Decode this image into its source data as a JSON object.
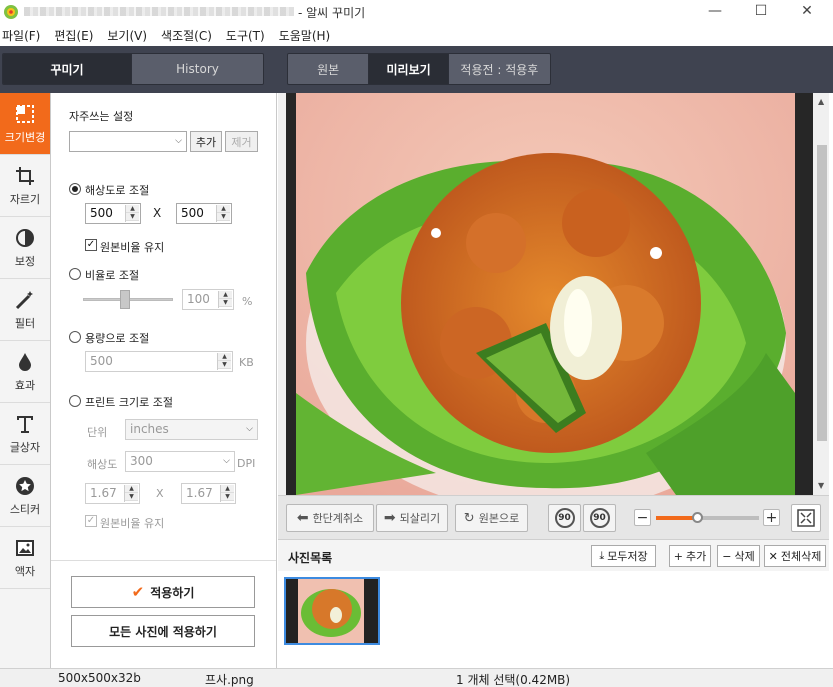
{
  "window": {
    "title": "- 알씨 꾸미기",
    "minimize": "—",
    "maximize": "☐",
    "close": "✕"
  },
  "menu": [
    "파일(F)",
    "편집(E)",
    "보기(V)",
    "색조절(C)",
    "도구(T)",
    "도움말(H)"
  ],
  "left_tabs": {
    "decorate": "꾸미기",
    "history": "History"
  },
  "view_tabs": {
    "original": "원본",
    "preview": "미리보기",
    "compare": "적용전 : 적용후"
  },
  "rail": [
    {
      "label": "크기변경",
      "icon": "resize-icon",
      "active": true
    },
    {
      "label": "자르기",
      "icon": "crop-icon"
    },
    {
      "label": "보정",
      "icon": "adjust-icon"
    },
    {
      "label": "필터",
      "icon": "filter-wand-icon"
    },
    {
      "label": "효과",
      "icon": "drop-icon"
    },
    {
      "label": "글상자",
      "icon": "text-icon"
    },
    {
      "label": "스티커",
      "icon": "sticker-star-icon"
    },
    {
      "label": "액자",
      "icon": "frame-icon"
    }
  ],
  "panel": {
    "favorites_label": "자주쓰는 설정",
    "favorites_value": "",
    "add_button": "추가",
    "remove_button": "제거",
    "by_resolution": "해상도로 조절",
    "width": "500",
    "height": "500",
    "x_sep": "X",
    "keep_ratio": "원본비율 유지",
    "by_ratio": "비율로 조절",
    "ratio_value": "100",
    "ratio_unit": "%",
    "by_size": "용량으로 조절",
    "size_value": "500",
    "size_unit": "KB",
    "by_print": "프린트 크기로 조절",
    "unit_label": "단위",
    "unit_value": "inches",
    "res_label": "해상도",
    "res_value": "300",
    "res_unit": "DPI",
    "print_w": "1.67",
    "print_h": "1.67",
    "print_keep_ratio": "원본비율 유지",
    "apply": "적용하기",
    "apply_all": "모든 사진에 적용하기"
  },
  "tools": {
    "undo": "한단계취소",
    "redo": "되살리기",
    "revert": "원본으로",
    "rotate_left": "90",
    "rotate_right": "90",
    "zoom_out": "−",
    "zoom_in": "+"
  },
  "zoom_level": 0.4,
  "photo_list": {
    "title": "사진목록",
    "save_all": "모두저장",
    "add": "추가",
    "delete": "삭제",
    "delete_all": "전체삭제"
  },
  "status": {
    "dims": "500x500x32b",
    "filename": "프사.png",
    "selection": "1 개체 선택(0.42MB)"
  },
  "colors": {
    "accent": "#f26a1b",
    "toolbar": "#3f4350"
  }
}
